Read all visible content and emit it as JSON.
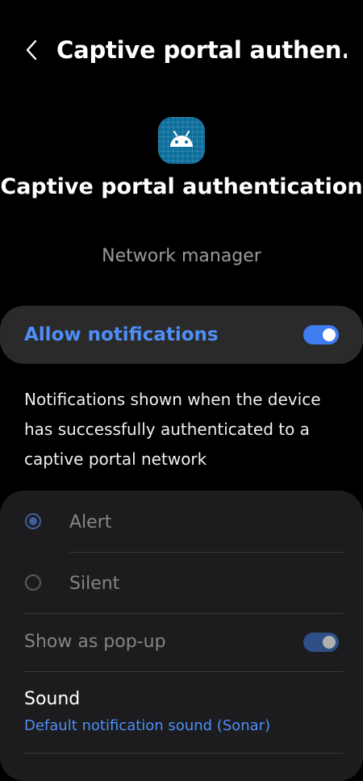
{
  "header": {
    "title": "Captive portal authen...",
    "back_icon": "chevron-left-icon"
  },
  "app": {
    "icon": "android-icon",
    "icon_color": "#0d6e9c",
    "name": "Captive portal authentication",
    "subtitle": "Network manager"
  },
  "allow_notifications": {
    "label": "Allow notifications",
    "enabled": true,
    "accent_color": "#4f8ef7"
  },
  "description": "Notifications shown when the device has successfully authenticated to a captive portal network",
  "alert_type": {
    "options": [
      {
        "label": "Alert",
        "selected": true
      },
      {
        "label": "Silent",
        "selected": false
      }
    ]
  },
  "popup": {
    "label": "Show as pop-up",
    "enabled": true
  },
  "sound": {
    "title": "Sound",
    "value": "Default notification sound (Sonar)"
  }
}
